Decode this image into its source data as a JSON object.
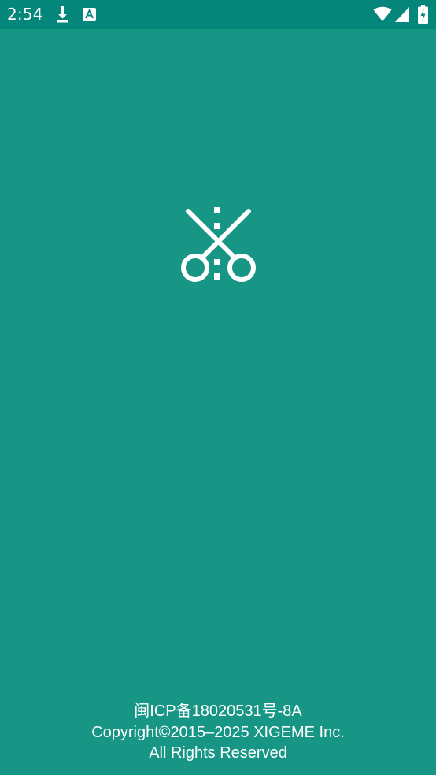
{
  "status_bar": {
    "time": "2:54",
    "left_icons": [
      "download-icon",
      "font-a-icon"
    ],
    "right_icons": [
      "wifi-icon",
      "cellular-signal-icon",
      "battery-charging-icon"
    ],
    "colors": {
      "bar_background": "#04877A",
      "foreground": "#FFFFFF"
    }
  },
  "splash": {
    "background_color": "#179686",
    "logo_icon": "scissors-cut-icon",
    "logo_color": "#FFFFFF"
  },
  "footer": {
    "icp_text": "闽ICP备18020531号-8A",
    "copyright_text": "Copyright©2015–2025 XIGEME Inc.",
    "rights_text": "All Rights Reserved"
  }
}
